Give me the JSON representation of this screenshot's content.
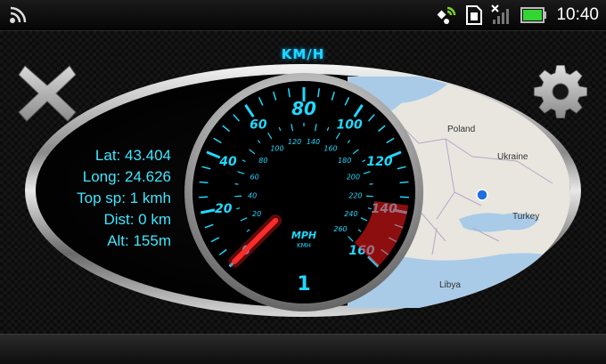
{
  "status_bar": {
    "time": "10:40",
    "icons": [
      "wifi-signal-icon",
      "gps-satellite-icon",
      "sim-card-icon",
      "cell-signal-off-icon",
      "battery-icon"
    ]
  },
  "speedometer": {
    "unit_label": "KM/H",
    "mph_label": "MPH",
    "kmh_label": "KMH",
    "gear_value": "1",
    "outer_scale": [
      "0",
      "20",
      "40",
      "60",
      "80",
      "100",
      "120",
      "140",
      "160"
    ],
    "inner_scale": [
      "0",
      "20",
      "40",
      "60",
      "80",
      "100",
      "120",
      "140",
      "160",
      "180",
      "200",
      "220",
      "240",
      "260"
    ],
    "needle_value_mph": 0
  },
  "info": {
    "lat": "Lat: 43.404",
    "long": "Long: 24.626",
    "top_speed": "Top sp: 1 kmh",
    "distance": "Dist: 0 km",
    "altitude": "Alt: 155m"
  },
  "map": {
    "labels": [
      "Poland",
      "Ukraine",
      "Turkey",
      "Libya"
    ],
    "location_marker_color": "#1e6fe0"
  },
  "controls": {
    "close_icon": "close-x-icon",
    "settings_icon": "gear-icon"
  },
  "colors": {
    "accent": "#20d8ff",
    "needle": "#ff2020"
  }
}
